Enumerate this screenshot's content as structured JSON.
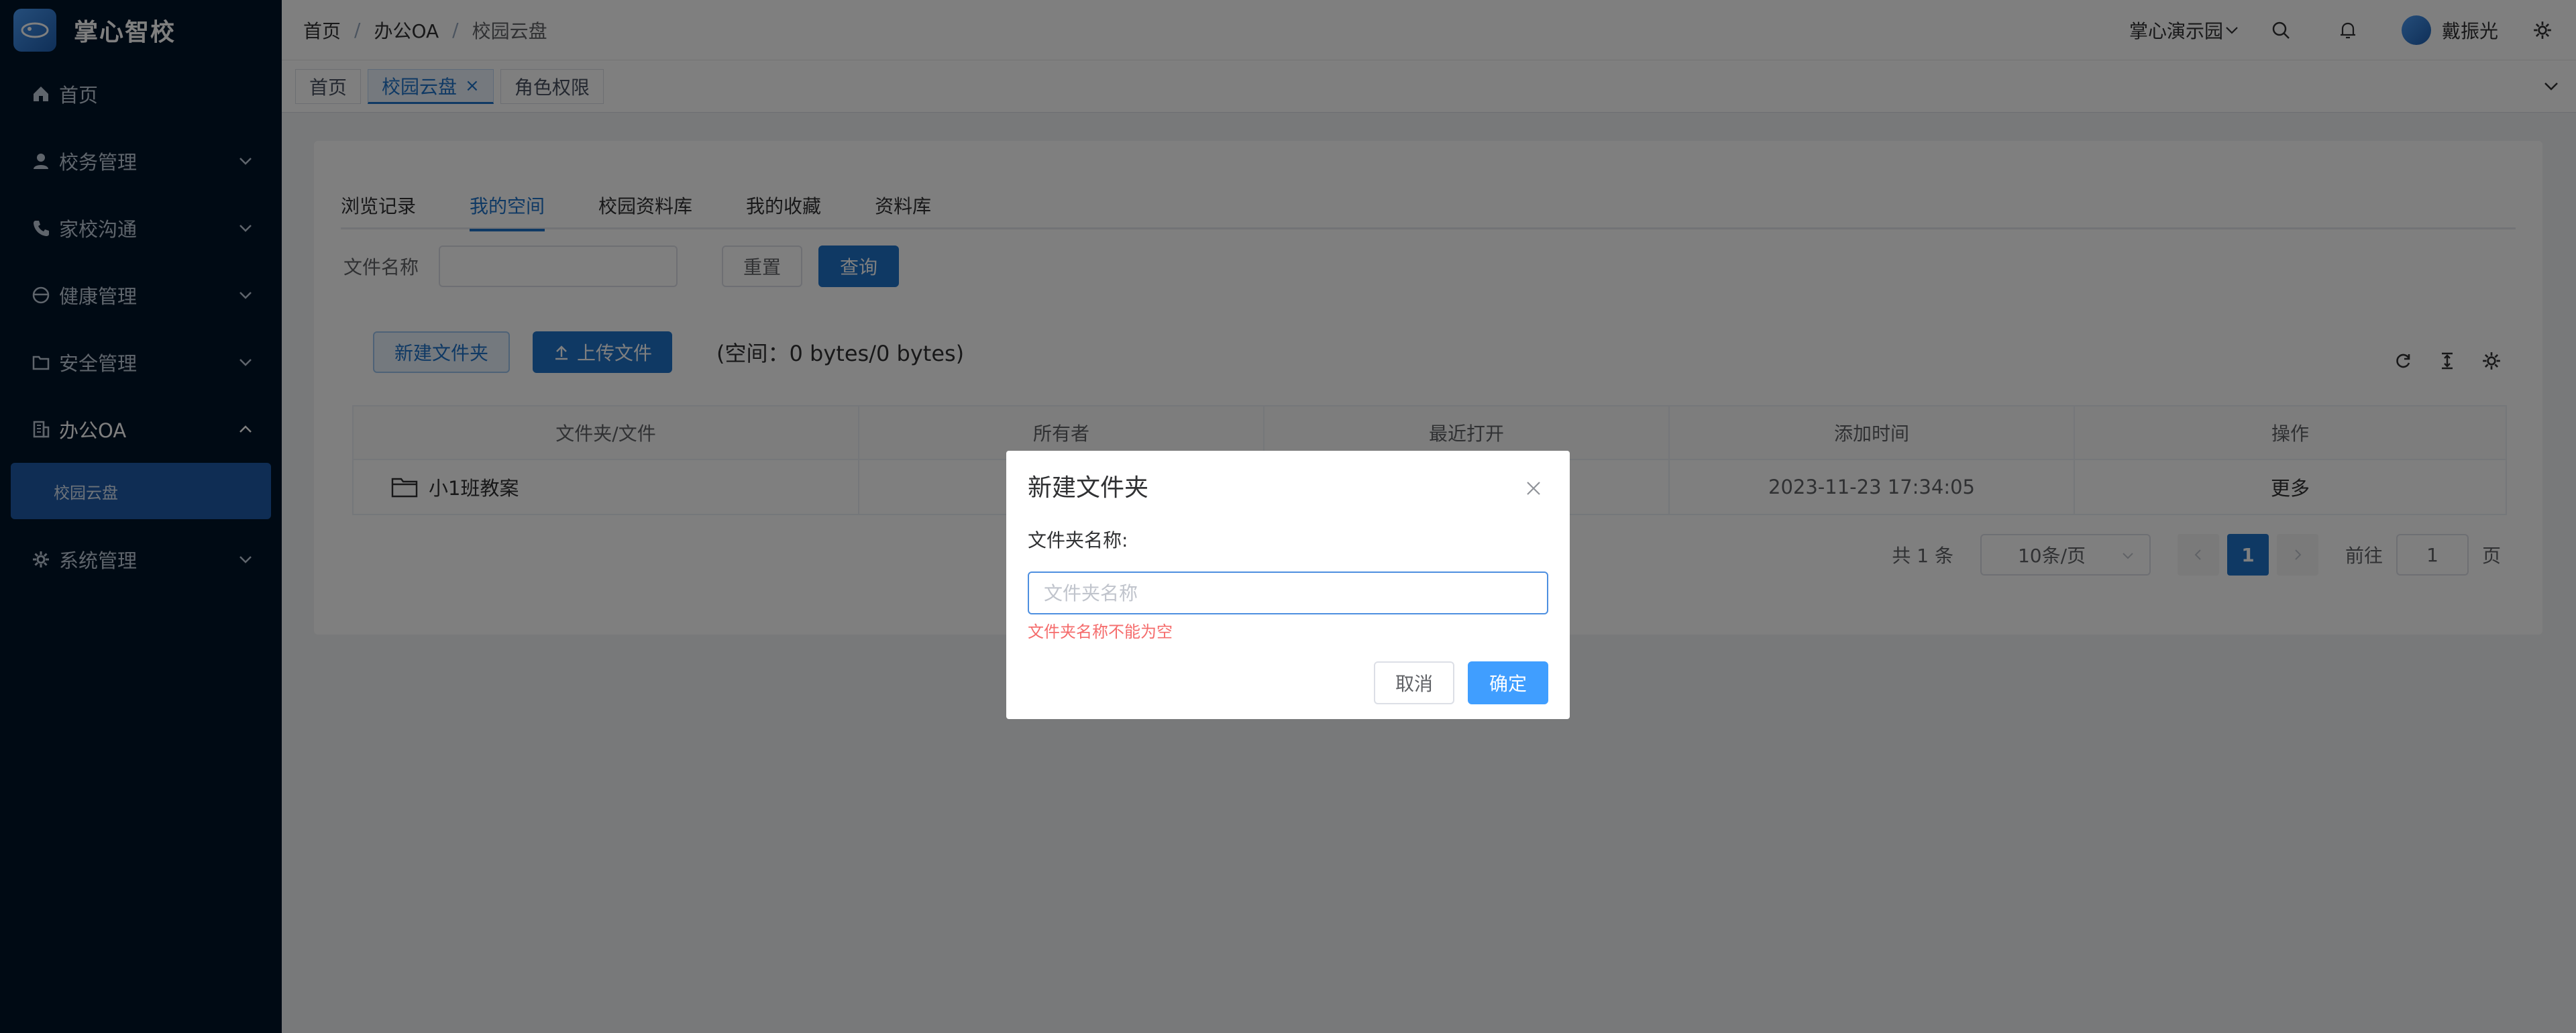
{
  "app": {
    "name": "掌心智校"
  },
  "sidebar": {
    "items": [
      {
        "label": "首页",
        "icon": "home-icon"
      },
      {
        "label": "校务管理",
        "icon": "user-icon"
      },
      {
        "label": "家校沟通",
        "icon": "phone-icon"
      },
      {
        "label": "健康管理",
        "icon": "health-icon"
      },
      {
        "label": "安全管理",
        "icon": "folder-icon"
      },
      {
        "label": "办公OA",
        "icon": "building-icon"
      },
      {
        "label": "系统管理",
        "icon": "gear-icon"
      }
    ],
    "sub_active": "校园云盘"
  },
  "header": {
    "breadcrumb": [
      "首页",
      "办公OA",
      "校园云盘"
    ],
    "school": "掌心演示园",
    "user": "戴振光"
  },
  "tags": [
    {
      "label": "首页"
    },
    {
      "label": "校园云盘",
      "close": "×"
    },
    {
      "label": "角色权限"
    }
  ],
  "tabs": [
    "浏览记录",
    "我的空间",
    "校园资料库",
    "我的收藏",
    "资料库"
  ],
  "search": {
    "label": "文件名称",
    "reset": "重置",
    "query": "查询"
  },
  "actions": {
    "new_folder": "新建文件夹",
    "upload": "上传文件",
    "space": "(空间：0 bytes/0 bytes)"
  },
  "table": {
    "headers": [
      "文件夹/文件",
      "所有者",
      "最近打开",
      "添加时间",
      "操作"
    ],
    "rows": [
      {
        "name": "小1班教案",
        "owner": "",
        "opened": "",
        "added": "2023-11-23 17:34:05",
        "op": "更多"
      }
    ]
  },
  "pagination": {
    "total": "共 1 条",
    "page_size": "10条/页",
    "current": "1",
    "goto_label": "前往",
    "goto_value": "1",
    "page_suffix": "页"
  },
  "dialog": {
    "title": "新建文件夹",
    "field_label": "文件夹名称:",
    "placeholder": "文件夹名称",
    "error": "文件夹名称不能为空",
    "cancel": "取消",
    "ok": "确定"
  },
  "colors": {
    "sidebar_bg": "#001529",
    "primary": "#1f72c9",
    "dialog_ok": "#409eff",
    "error": "#f56c6c"
  }
}
